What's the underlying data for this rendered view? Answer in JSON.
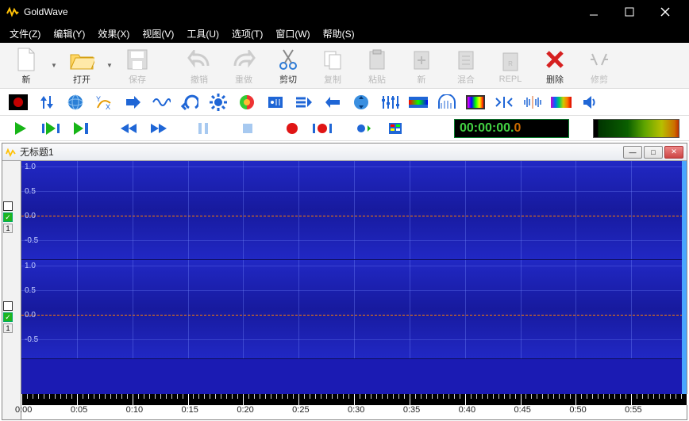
{
  "app": {
    "title": "GoldWave"
  },
  "menu": {
    "file": "文件(Z)",
    "edit": "编辑(Y)",
    "effect": "效果(X)",
    "view": "视图(V)",
    "tool": "工具(U)",
    "options": "选项(T)",
    "window": "窗口(W)",
    "help": "帮助(S)"
  },
  "toolbar": {
    "new": "新",
    "open": "打开",
    "save": "保存",
    "undo": "撤销",
    "redo": "重做",
    "cut": "剪切",
    "copy": "复制",
    "paste": "粘贴",
    "new2": "新",
    "mix": "混合",
    "repl": "REPL",
    "delete": "删除",
    "trim": "修剪"
  },
  "time": {
    "main": "00:00:00.",
    "fraction": "0"
  },
  "doc": {
    "title": "无标题1"
  },
  "amp_labels": [
    "1.0",
    "0.5",
    "0.0",
    "-0.5"
  ],
  "time_labels": [
    "0:00",
    "0:05",
    "0:10",
    "0:15",
    "0:20",
    "0:25",
    "0:30",
    "0:35",
    "0:40",
    "0:45",
    "0:50",
    "0:55"
  ],
  "markers": {
    "check": "✓",
    "one": "1"
  }
}
